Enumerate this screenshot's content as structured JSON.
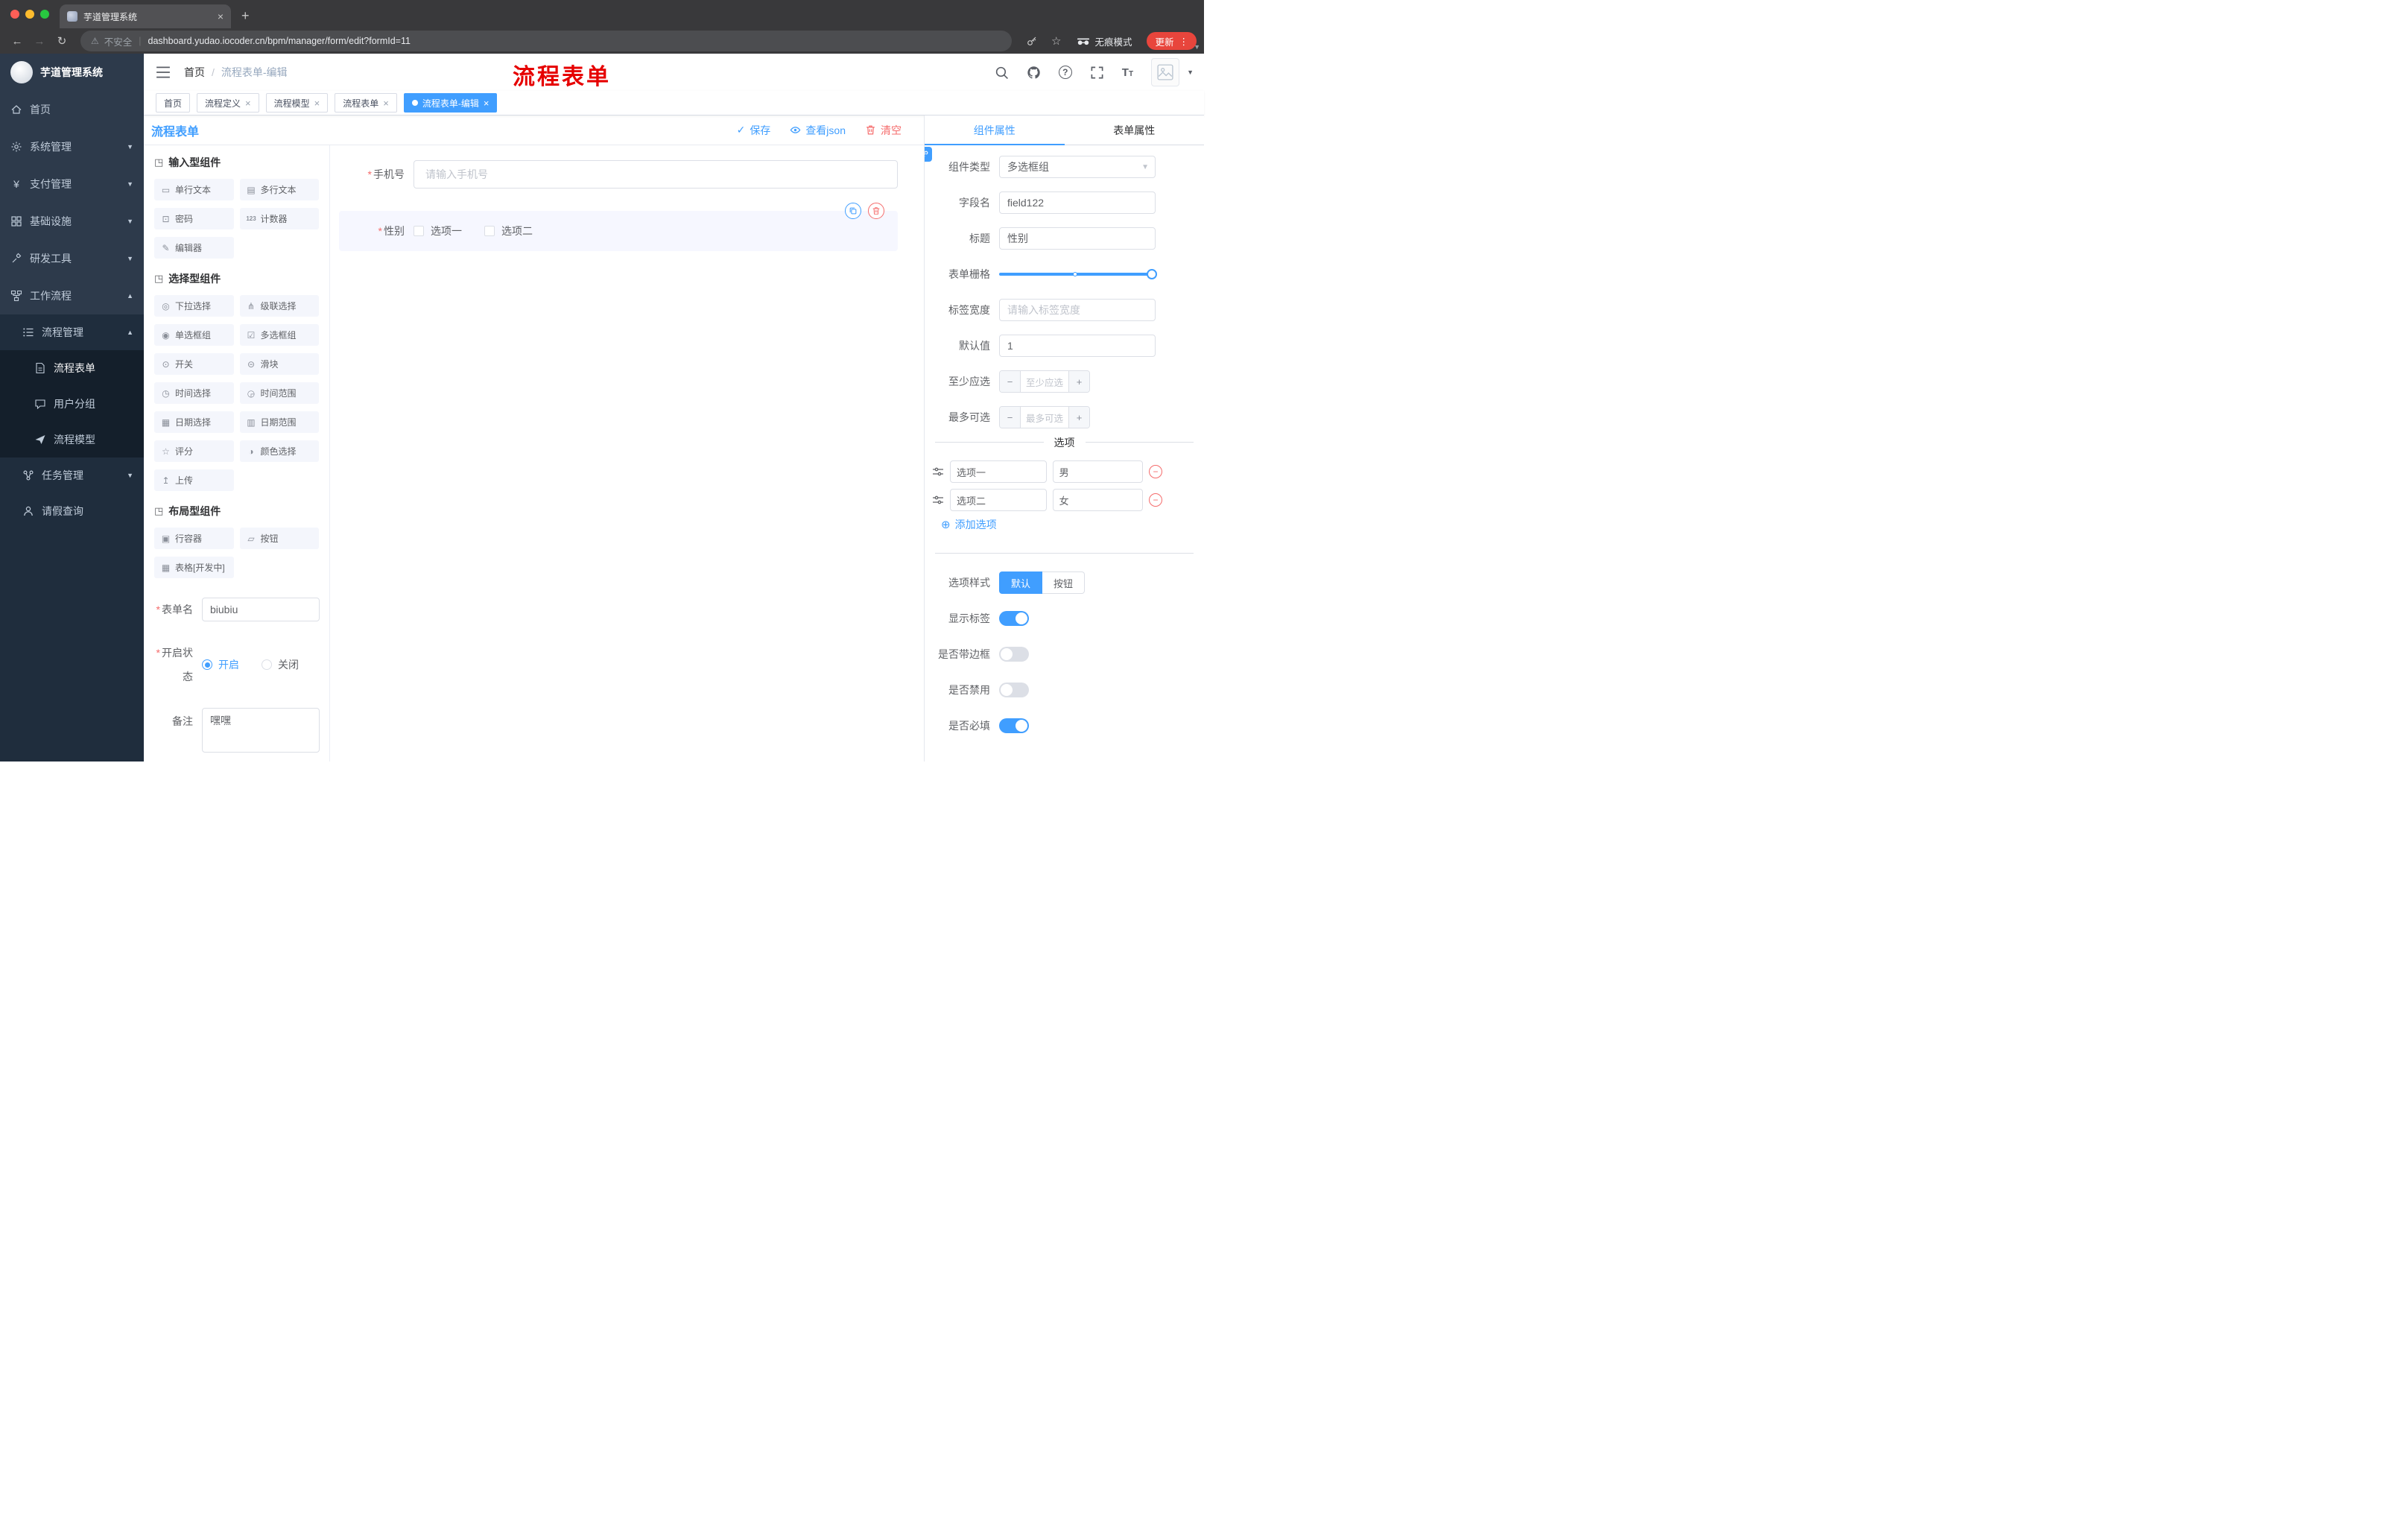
{
  "colors": {
    "accent": "#409eff",
    "danger": "#f56c6c",
    "annotation": "#e60000",
    "sidebar_bg": "#2d3a4b"
  },
  "ui": {
    "required_mark": "*"
  },
  "browser": {
    "tab_title": "芋道管理系统",
    "security_label": "不安全",
    "url": "dashboard.yudao.iocoder.cn/bpm/manager/form/edit?formId=11",
    "incognito_label": "无痕模式",
    "update_label": "更新"
  },
  "sidebar": {
    "logo_title": "芋道管理系统",
    "items": [
      {
        "label": "首页",
        "icon": "home"
      },
      {
        "label": "系统管理",
        "icon": "gear",
        "expandable": true
      },
      {
        "label": "支付管理",
        "icon": "yen",
        "expandable": true
      },
      {
        "label": "基础设施",
        "icon": "grid",
        "expandable": true
      },
      {
        "label": "研发工具",
        "icon": "tool",
        "expandable": true
      },
      {
        "label": "工作流程",
        "icon": "workflow",
        "expanded": true
      },
      {
        "label": "流程管理",
        "icon": "list",
        "expanded": true
      },
      {
        "label": "流程表单",
        "icon": "document",
        "active": true
      },
      {
        "label": "用户分组",
        "icon": "chat"
      },
      {
        "label": "流程模型",
        "icon": "send"
      },
      {
        "label": "任务管理",
        "icon": "share",
        "expandable": true
      },
      {
        "label": "请假查询",
        "icon": "person"
      }
    ]
  },
  "header": {
    "breadcrumb_home": "首页",
    "breadcrumb_current": "流程表单-编辑",
    "annotation": "流程表单"
  },
  "tags": [
    {
      "label": "首页",
      "closable": false,
      "active": false
    },
    {
      "label": "流程定义",
      "closable": true,
      "active": false
    },
    {
      "label": "流程模型",
      "closable": true,
      "active": false
    },
    {
      "label": "流程表单",
      "closable": true,
      "active": false
    },
    {
      "label": "流程表单-编辑",
      "closable": true,
      "active": true
    }
  ],
  "toolbar": {
    "title": "流程表单",
    "save": "保存",
    "view_json": "查看json",
    "clear": "清空"
  },
  "palette": {
    "sections": [
      {
        "title": "输入型组件",
        "items": [
          {
            "label": "单行文本",
            "icon": "input"
          },
          {
            "label": "多行文本",
            "icon": "textarea"
          },
          {
            "label": "密码",
            "icon": "password"
          },
          {
            "label": "计数器",
            "icon": "counter"
          },
          {
            "label": "编辑器",
            "icon": "editor"
          }
        ]
      },
      {
        "title": "选择型组件",
        "items": [
          {
            "label": "下拉选择",
            "icon": "select"
          },
          {
            "label": "级联选择",
            "icon": "cascader"
          },
          {
            "label": "单选框组",
            "icon": "radio-group"
          },
          {
            "label": "多选框组",
            "icon": "checkbox-group"
          },
          {
            "label": "开关",
            "icon": "switch"
          },
          {
            "label": "滑块",
            "icon": "slider"
          },
          {
            "label": "时间选择",
            "icon": "time-picker"
          },
          {
            "label": "时间范围",
            "icon": "time-range"
          },
          {
            "label": "日期选择",
            "icon": "date-picker"
          },
          {
            "label": "日期范围",
            "icon": "date-range"
          },
          {
            "label": "评分",
            "icon": "rate"
          },
          {
            "label": "颜色选择",
            "icon": "color-picker"
          },
          {
            "label": "上传",
            "icon": "upload"
          }
        ]
      },
      {
        "title": "布局型组件",
        "items": [
          {
            "label": "行容器",
            "icon": "row-container"
          },
          {
            "label": "按钮",
            "icon": "button"
          },
          {
            "label": "表格[开发中]",
            "icon": "table"
          }
        ]
      }
    ],
    "form_meta": {
      "name_label": "表单名",
      "name_value": "biubiu",
      "status_label": "开启状态",
      "status_on": "开启",
      "status_off": "关闭",
      "status_selected": "开启",
      "remark_label": "备注",
      "remark_value": "嘿嘿"
    }
  },
  "canvas": {
    "phone": {
      "label": "手机号",
      "required": true,
      "placeholder": "请输入手机号"
    },
    "gender": {
      "label": "性别",
      "required": true,
      "options": [
        "选项一",
        "选项二"
      ],
      "selected": true
    }
  },
  "props": {
    "tab_component": "组件属性",
    "tab_form": "表单属性",
    "active_tab": "组件属性",
    "component_type_label": "组件类型",
    "component_type_value": "多选框组",
    "field_name_label": "字段名",
    "field_name_value": "field122",
    "title_label": "标题",
    "title_value": "性别",
    "grid_label": "表单栅格",
    "label_width_label": "标签宽度",
    "label_width_placeholder": "请输入标签宽度",
    "default_label": "默认值",
    "default_value": "1",
    "min_label": "至少应选",
    "min_placeholder": "至少应选",
    "max_label": "最多可选",
    "max_placeholder": "最多可选",
    "options_title": "选项",
    "options": [
      {
        "label": "选项一",
        "value": "男"
      },
      {
        "label": "选项二",
        "value": "女"
      }
    ],
    "add_option": "添加选项",
    "style_label": "选项样式",
    "style_default": "默认",
    "style_button": "按钮",
    "style_selected": "默认",
    "switches": [
      {
        "label": "显示标签",
        "on": true
      },
      {
        "label": "是否带边框",
        "on": false
      },
      {
        "label": "是否禁用",
        "on": false
      },
      {
        "label": "是否必填",
        "on": true
      }
    ]
  }
}
